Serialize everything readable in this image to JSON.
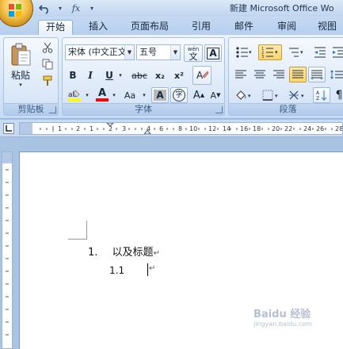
{
  "title_bar": {
    "title": "新建 Microsoft Office Wo",
    "qat": [
      "save-icon",
      "undo-icon",
      "fx-icon"
    ],
    "fx_label": "fx"
  },
  "tabs": [
    "开始",
    "插入",
    "页面布局",
    "引用",
    "邮件",
    "审阅",
    "视图"
  ],
  "clipboard": {
    "paste_label": "粘贴",
    "group_label": "剪贴板"
  },
  "font": {
    "font_name": "宋体 (中文正文",
    "font_size": "五号",
    "phonetic": "wén",
    "bold": "B",
    "italic": "I",
    "underline": "U",
    "strike": "abc",
    "subscript": "x₂",
    "superscript": "x²",
    "change_case": "Aa",
    "shade_char": "A",
    "enclose_char": "字",
    "grow": "A",
    "shrink": "A",
    "group_label": "字体",
    "highlight_color": "#ffff00",
    "font_color": "#ff0000"
  },
  "paragraph": {
    "group_label": "段落"
  },
  "document": {
    "line1_number": "1.",
    "line1_text": "以及标题",
    "line2_number": "1.1",
    "pilcrow": "↵"
  },
  "watermark": {
    "text": "Baidu 经验",
    "sub": "jingyan.baidu.com"
  }
}
